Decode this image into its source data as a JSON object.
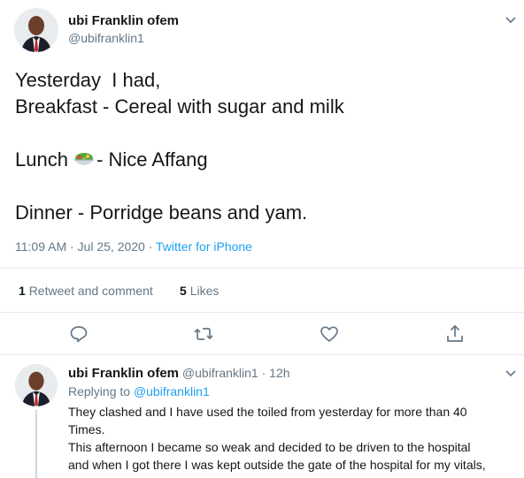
{
  "tweet": {
    "author_name": "ubi Franklin ofem",
    "author_handle": "@ubifranklin1",
    "lines": [
      "Yesterday  I had,",
      "Breakfast - Cereal with sugar and milk",
      "",
      "- Nice Affang",
      "",
      "Dinner - Porridge beans and yam."
    ],
    "lunch_prefix": "Lunch ",
    "lunch_emoji_icon": "green-salad-emoji",
    "timestamp": "11:09 AM · Jul 25, 2020 · ",
    "source": "Twitter for iPhone",
    "retweet_count": "1",
    "retweet_label": "Retweet and comment",
    "like_count": "5",
    "like_label": "Likes"
  },
  "actions": {
    "reply_icon": "reply-icon",
    "retweet_icon": "retweet-icon",
    "like_icon": "heart-icon",
    "share_icon": "share-icon"
  },
  "reply": {
    "author_name": "ubi Franklin ofem",
    "author_handle": "@ubifranklin1",
    "time": "· 12h",
    "replying_prefix": "Replying to ",
    "replying_to": "@ubifranklin1",
    "lines": [
      "They clashed and I have used the toiled from yesterday for more than 40",
      "Times.",
      "This afternoon I became so weak and decided to be driven to the hospital",
      "and when I got there I was kept outside the gate of the hospital for my vitals,"
    ]
  },
  "colors": {
    "accent": "#1da1f2",
    "secondary_text": "#657786",
    "divider": "#e6ecf0"
  }
}
